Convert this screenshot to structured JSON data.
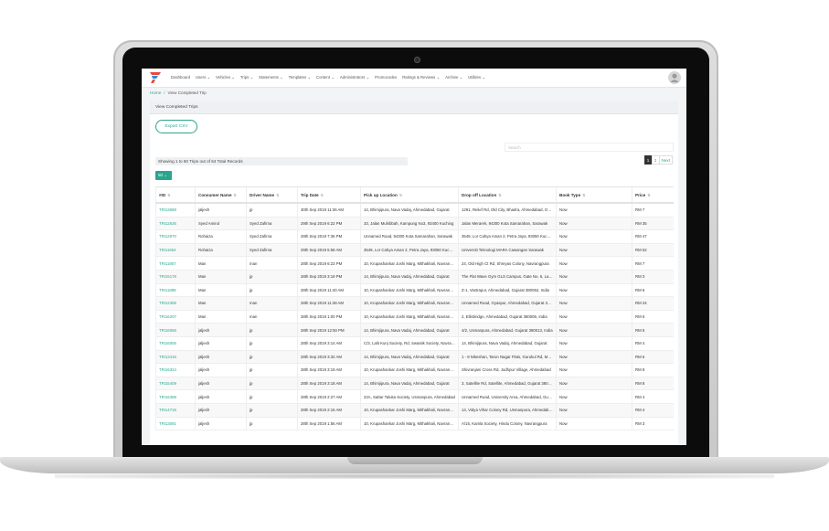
{
  "nav": {
    "items": [
      "Dashboard",
      "Users ⌄",
      "Vehicles ⌄",
      "Trips ⌄",
      "Statements ⌄",
      "Templates ⌄",
      "Content ⌄",
      "Administrators ⌄",
      "Promocodes",
      "Ratings & Reviews ⌄",
      "Archive ⌄",
      "Utilities ⌄"
    ]
  },
  "breadcrumb": {
    "home": "Home",
    "separator": "/",
    "current": "View Completed Trip"
  },
  "panel": {
    "title": "View Completed Trips",
    "export_label": "Export CSV",
    "search_placeholder": "Search",
    "showing_text": "Showing 1 to 50 Trips out of 64 Total Records",
    "per_page": "50 ⌄",
    "pagination": [
      "1",
      "2",
      "Next"
    ]
  },
  "table": {
    "columns": [
      "#ID",
      "Consumer Name",
      "Driver Name",
      "Trip Date",
      "Pick up Location",
      "Drop off Location",
      "Book Type",
      "Price"
    ],
    "rows": [
      [
        "TRI13688",
        "jaljesh",
        "jp",
        "30th Sep 2019 11:36 AM",
        "14, Bhimjipura, Nava Vadaj, Ahmedabad, Gujarat",
        "1291, Relief Rd, Old City, Bhadra, Ahmedabad, Gujarat",
        "Now",
        "RM 7"
      ],
      [
        "TRI12636",
        "Syed Amirul",
        "Syed Zafirna",
        "29th Sep 2019 6:22 PM",
        "33, Jalan Muhibbah, Kampung No3, 93400 Kuching",
        "Jalan Merarek, 94300 Kota Samarahan, Sarawak",
        "Now",
        "RM 35"
      ],
      [
        "TRI12970",
        "Rohaiza",
        "Syed Zafirna",
        "29th Sep 2019 7:36 PM",
        "Unnamed Road, 94300 Kota Samarahan, Sarawak",
        "3549, Lor Cahya Aman 2, Petra Jaya, 93050 Kuching",
        "Now",
        "RM 47"
      ],
      [
        "TRI11664",
        "Rohaiza",
        "Syed Zafirna",
        "29th Sep 2019 5:58 AM",
        "3549, Lor Cahya Aman 2, Petra Jaya, 93050 Kuching",
        "Universiti Teknologi MARA Cawangan Sarawak",
        "Now",
        "RM 52"
      ],
      [
        "TRI11907",
        "Man",
        "man",
        "28th Sep 2019 6:23 PM",
        "10, Krupashankar Joshi Marg, Mithakhali, Navrangpura",
        "24, Old High Ct Rd, Shreyas Colony, Navrangpura",
        "Now",
        "RM 7"
      ],
      [
        "TRI15178",
        "Man",
        "jp",
        "28th Sep 2019 3:19 PM",
        "14, Bhimjipura, Nava Vadaj, Ahmedabad, Gujarat",
        "The Flat Wave Gym GLS Campus, Gate No. 6, Law Garden",
        "Now",
        "RM 3"
      ],
      [
        "TRI11899",
        "Man",
        "jp",
        "28th Sep 2019 11:40 AM",
        "10, Krupashankar Joshi Marg, Mithakhali, Navrangpura",
        "Z-1, Vastrapur, Ahmedabad, Gujarat 380052, India",
        "Now",
        "RM 6"
      ],
      [
        "TRI12395",
        "Man",
        "man",
        "28th Sep 2019 11:38 AM",
        "10, Krupashankar Joshi Marg, Mithakhali, Navrangpura",
        "Unnamed Road, Gyaspur, Ahmedabad, Gujarat 382210",
        "Now",
        "RM 24"
      ],
      [
        "TRI16207",
        "Man",
        "man",
        "28th Sep 2019 1:00 PM",
        "10, Krupashankar Joshi Marg, Mithakhali, Navrangpura",
        "2, Ellisbridge, Ahmedabad, Gujarat 380006, India",
        "Now",
        "RM 6"
      ],
      [
        "TRI16065",
        "jaljesh",
        "jp",
        "28th Sep 2019 12:50 PM",
        "14, Bhimjipura, Nava Vadaj, Ahmedabad, Gujarat",
        "4/2, Usmanpura, Ahmedabad, Gujarat 380013, India",
        "Now",
        "RM 5"
      ],
      [
        "TRI16006",
        "jaljesh",
        "jp",
        "28th Sep 2019 3:14 AM",
        "C/3, Lalit Kunj Society, Rd, Swastik Society, Navrangpura",
        "14, Bhimjipura, Nava Vadaj, Ahmedabad, Gujarat",
        "Now",
        "RM 4"
      ],
      [
        "TRI13416",
        "jaljesh",
        "jp",
        "28th Sep 2019 3:32 AM",
        "14, Bhimjipura, Nava Vadaj, Ahmedabad, Gujarat",
        "1 - 8 Nikeshan, Tarun Nagar Flats, Gurukul Rd, Memnagar",
        "Now",
        "RM 6"
      ],
      [
        "TRI16324",
        "jaljesh",
        "jp",
        "28th Sep 2019 3:19 AM",
        "10, Krupashankar Joshi Marg, Mithakhali, Navrangpura",
        "Shivranjani Cross Rd, Jodhpur Village, Ahmedabad",
        "Now",
        "RM 8"
      ],
      [
        "TRI15409",
        "jaljesh",
        "jp",
        "28th Sep 2019 3:18 AM",
        "14, Bhimjipura, Nava Vadaj, Ahmedabad, Gujarat",
        "3, Satellite Rd, Satellite, Ahmedabad, Gujarat 380015",
        "Now",
        "RM 8"
      ],
      [
        "TRI16398",
        "jaljesh",
        "jp",
        "28th Sep 2019 2:27 AM",
        "22A, Sattar Taluka Society, Usmanpura, Ahmedabad",
        "Unnamed Road, University Area, Ahmedabad, Gujarat",
        "Now",
        "RM 4"
      ],
      [
        "TRI14716",
        "jaljesh",
        "jp",
        "28th Sep 2019 2:15 AM",
        "10, Krupashankar Joshi Marg, Mithakhali, Navrangpura",
        "14, Vidya Vihar Colony Rd, Usmanpura, Ahmedabad",
        "Now",
        "RM 4"
      ],
      [
        "TRI13091",
        "jaljesh",
        "jp",
        "28th Sep 2019 1:56 AM",
        "10, Krupashankar Joshi Marg, Mithakhali, Navrangpura",
        "A/15, Kamla Society, Hindu Colony, Navrangpura",
        "Now",
        "RM 3"
      ]
    ]
  }
}
